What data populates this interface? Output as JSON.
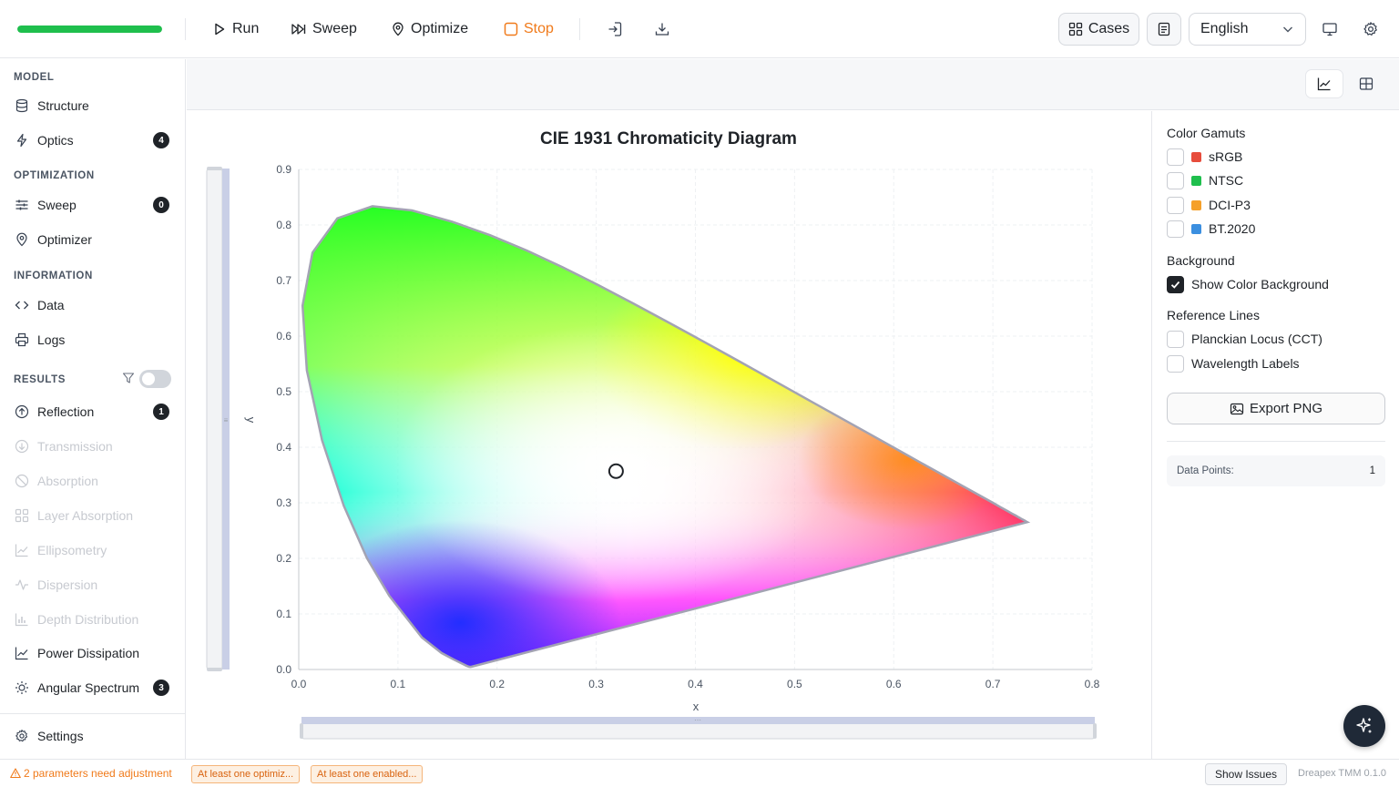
{
  "toolbar": {
    "progress": 1.0,
    "run_label": "Run",
    "sweep_label": "Sweep",
    "optimize_label": "Optimize",
    "stop_label": "Stop",
    "cases_label": "Cases",
    "language": "English"
  },
  "sidebar": {
    "sections": [
      {
        "title": "MODEL",
        "items": [
          {
            "label": "Structure",
            "icon": "database-icon"
          },
          {
            "label": "Optics",
            "icon": "lightning-icon",
            "badge": "4"
          }
        ]
      },
      {
        "title": "OPTIMIZATION",
        "items": [
          {
            "label": "Sweep",
            "icon": "sliders-icon",
            "badge": "0"
          },
          {
            "label": "Optimizer",
            "icon": "map-pin-icon"
          }
        ]
      },
      {
        "title": "INFORMATION",
        "items": [
          {
            "label": "Data",
            "icon": "code-icon"
          },
          {
            "label": "Logs",
            "icon": "printer-icon"
          }
        ]
      },
      {
        "title": "RESULTS",
        "items": [
          {
            "label": "Reflection",
            "icon": "arrow-up-circle-icon",
            "badge": "1"
          },
          {
            "label": "Transmission",
            "icon": "arrow-down-circle-icon",
            "disabled": true
          },
          {
            "label": "Absorption",
            "icon": "ban-icon",
            "disabled": true
          },
          {
            "label": "Layer Absorption",
            "icon": "grid-icon",
            "disabled": true
          },
          {
            "label": "Ellipsometry",
            "icon": "chart-line-icon",
            "disabled": true
          },
          {
            "label": "Dispersion",
            "icon": "activity-icon",
            "disabled": true
          },
          {
            "label": "Depth Distribution",
            "icon": "bar-chart-icon",
            "disabled": true
          },
          {
            "label": "Power Dissipation",
            "icon": "chart-line-icon"
          },
          {
            "label": "Angular Spectrum",
            "icon": "sun-icon",
            "badge": "3"
          }
        ]
      }
    ],
    "results_filter_enabled": false,
    "settings_label": "Settings"
  },
  "chart_data": {
    "type": "scatter",
    "title": "CIE 1931 Chromaticity Diagram",
    "xlabel": "x",
    "ylabel": "y",
    "xlim": [
      0.0,
      0.8
    ],
    "ylim": [
      0.0,
      0.9
    ],
    "x_ticks": [
      "0.0",
      "0.1",
      "0.2",
      "0.3",
      "0.4",
      "0.5",
      "0.6",
      "0.7",
      "0.8"
    ],
    "y_ticks": [
      "0.0",
      "0.1",
      "0.2",
      "0.3",
      "0.4",
      "0.5",
      "0.6",
      "0.7",
      "0.8",
      "0.9"
    ],
    "grid": true,
    "color_background": true,
    "points": [
      {
        "x": 0.32,
        "y": 0.357
      }
    ]
  },
  "right_panel": {
    "gamuts_heading": "Color Gamuts",
    "gamuts": [
      {
        "label": "sRGB",
        "color": "#e74c3c",
        "checked": false
      },
      {
        "label": "NTSC",
        "color": "#1fbf4d",
        "checked": false
      },
      {
        "label": "DCI-P3",
        "color": "#f5a02a",
        "checked": false
      },
      {
        "label": "BT.2020",
        "color": "#3b8fe0",
        "checked": false
      }
    ],
    "background_heading": "Background",
    "show_background_label": "Show Color Background",
    "show_background_checked": true,
    "reference_heading": "Reference Lines",
    "planckian_label": "Planckian Locus (CCT)",
    "wavelength_label": "Wavelength Labels",
    "export_label": "Export PNG",
    "data_points_label": "Data Points:",
    "data_points_value": "1"
  },
  "statusbar": {
    "warning_text": "2 parameters need adjustment",
    "chips": [
      "At least one optimiz...",
      "At least one enabled..."
    ],
    "show_issues_label": "Show Issues",
    "version": "Dreapex TMM 0.1.0"
  }
}
